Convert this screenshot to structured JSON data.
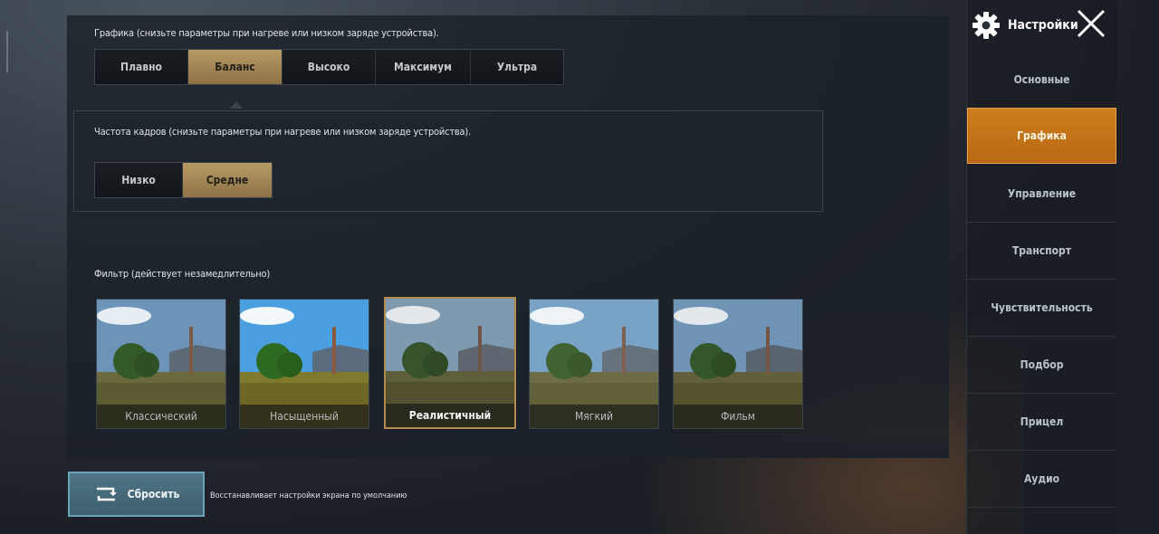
{
  "graphics": {
    "label": "Графика (снизьте параметры при нагреве или низком заряде устройства).",
    "options": [
      "Плавно",
      "Баланс",
      "Высоко",
      "Максимум",
      "Ультра"
    ],
    "selected": "Баланс"
  },
  "fps": {
    "label": "Частота кадров (снизьте параметры при нагреве или низком заряде устройства).",
    "options": [
      "Низко",
      "Средне"
    ],
    "selected": "Средне"
  },
  "filter": {
    "label": "Фильтр (действует незамедлительно)",
    "options": [
      "Классический",
      "Насыщенный",
      "Реалистичный",
      "Мягкий",
      "Фильм"
    ],
    "selected": "Реалистичный"
  },
  "reset": {
    "label": "Сбросить",
    "description": "Восстанавливает настройки экрана по умолчанию",
    "icon": "reset-icon"
  },
  "sidebar": {
    "title": "Настройки",
    "icons": {
      "settings": "gear-icon",
      "close": "close-icon"
    },
    "items": [
      "Основные",
      "Графика",
      "Управление",
      "Транспорт",
      "Чувствительность",
      "Подбор",
      "Прицел",
      "Аудио"
    ],
    "active": "Графика"
  },
  "colors": {
    "accent_gold": "#a88a58",
    "accent_orange": "#c8761a",
    "reset_teal": "#4a7081"
  }
}
